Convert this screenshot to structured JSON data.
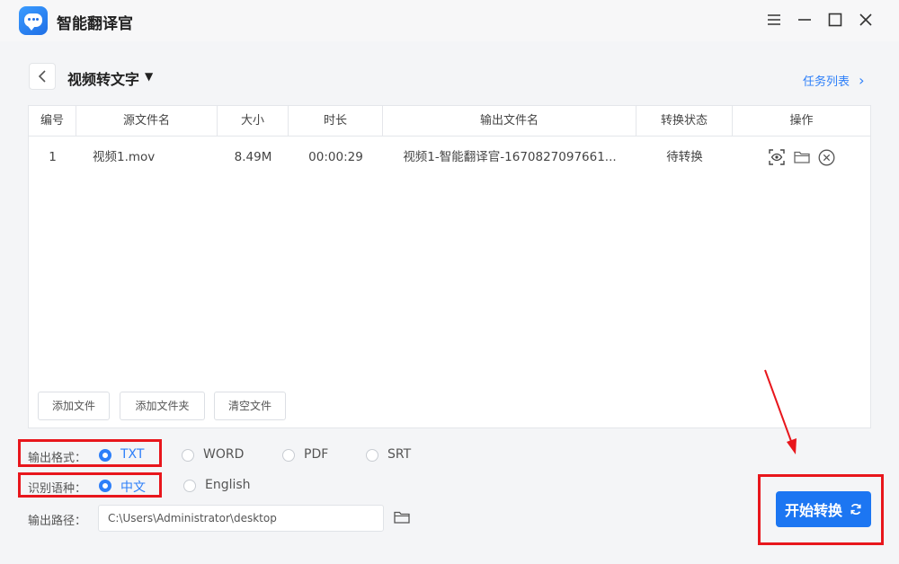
{
  "app": {
    "title": "智能翻译官"
  },
  "window": {
    "menu_icon": "menu-icon",
    "min_icon": "minimize-icon",
    "max_icon": "maximize-icon",
    "close_icon": "close-icon"
  },
  "header": {
    "back_icon": "chevron-left-icon",
    "title": "视频转文字",
    "title_caret": "▼",
    "task_list_link": "任务列表",
    "task_list_chevron": "›"
  },
  "table": {
    "columns": [
      "编号",
      "源文件名",
      "大小",
      "时长",
      "输出文件名",
      "转换状态",
      "操作"
    ],
    "rows": [
      {
        "index": "1",
        "source": "视频1.mov",
        "size": "8.49M",
        "duration": "00:00:29",
        "output": "视频1-智能翻译官-1670827097661...",
        "status": "待转换",
        "actions": [
          "preview-icon",
          "folder-icon",
          "remove-icon"
        ]
      }
    ],
    "buttons": {
      "add_file": "添加文件",
      "add_folder": "添加文件夹",
      "clear_files": "清空文件"
    }
  },
  "settings": {
    "format_label": "输出格式：",
    "formats": [
      "TXT",
      "WORD",
      "PDF",
      "SRT"
    ],
    "selected_format": "TXT",
    "language_label": "识别语种：",
    "languages": [
      "中文",
      "English"
    ],
    "selected_language": "中文",
    "path_label": "输出路径：",
    "path_value": "C:\\Users\\Administrator\\desktop",
    "path_icon": "folder-icon"
  },
  "actions": {
    "start_label": "开始转换",
    "start_icon": "refresh-icon"
  },
  "colors": {
    "accent": "#1c76f2",
    "highlight": "#e8161c"
  }
}
